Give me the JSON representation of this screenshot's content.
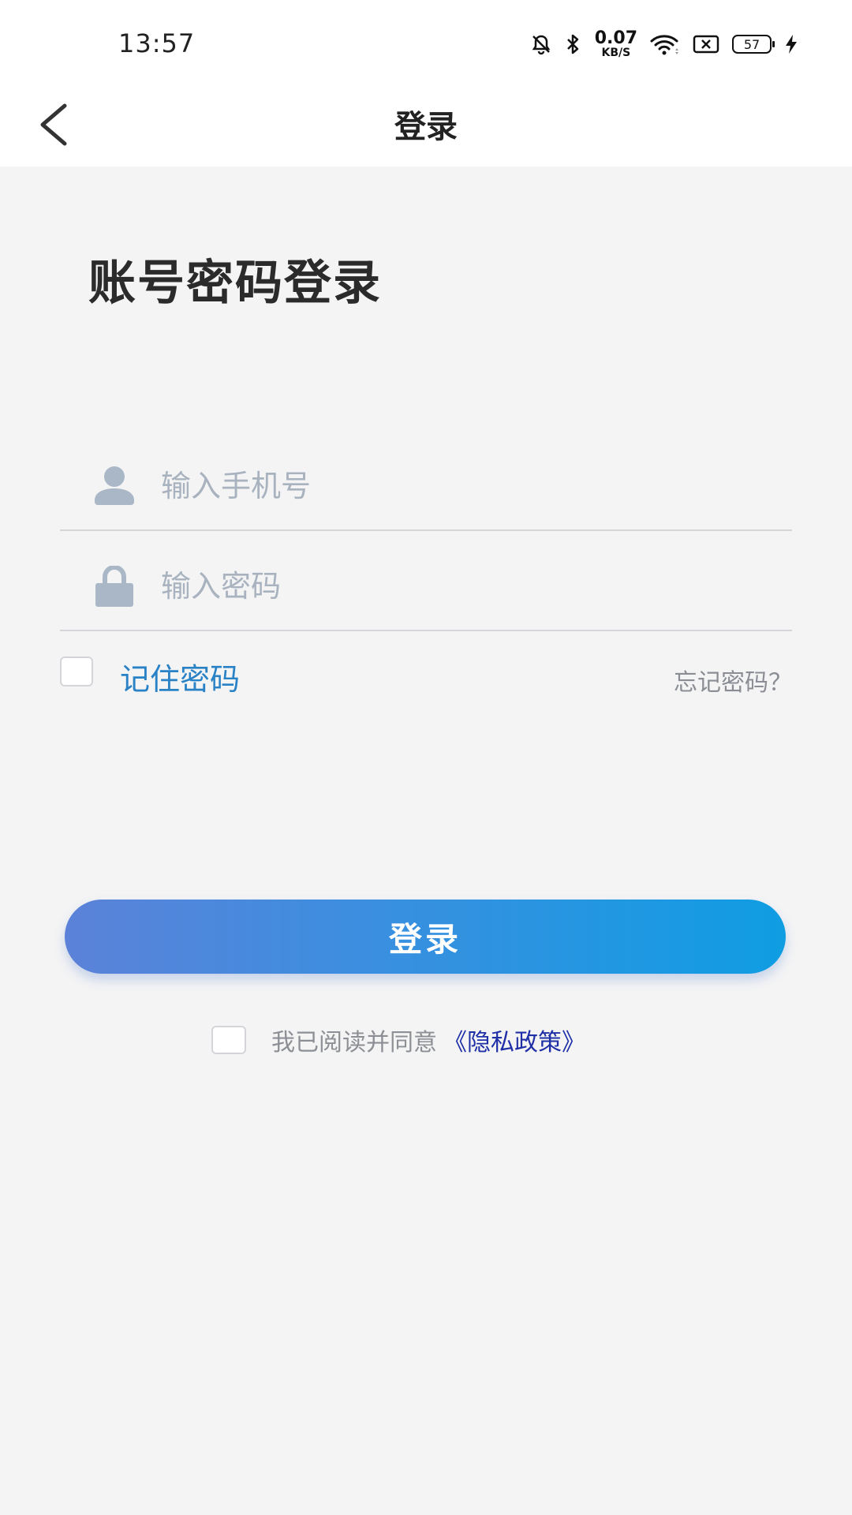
{
  "status_bar": {
    "time": "13:57",
    "net_speed_value": "0.07",
    "net_speed_unit": "KB/S",
    "battery_level": "57",
    "icons": [
      "bell-off-icon",
      "bluetooth-icon",
      "wifi-icon",
      "sim-off-icon",
      "battery-icon",
      "charging-icon"
    ]
  },
  "nav": {
    "back_icon": "chevron-left-icon",
    "title": "登录"
  },
  "heading": "账号密码登录",
  "form": {
    "phone": {
      "icon": "user-icon",
      "value": "",
      "placeholder": "输入手机号"
    },
    "password": {
      "icon": "lock-icon",
      "value": "",
      "placeholder": "输入密码"
    },
    "remember_label": "记住密码",
    "remember_checked": false,
    "forgot_label": "忘记密码？"
  },
  "login_button_label": "登录",
  "agreement": {
    "checked": false,
    "text": "我已阅读并同意",
    "link_label": "《隐私政策》"
  },
  "colors": {
    "accent_blue": "#2a82c6",
    "link_dark_blue": "#1f2fa6",
    "button_gradient_start": "#5b82d8",
    "button_gradient_end": "#0f9de2",
    "icon_gray": "#a9b7c6",
    "background": "#f4f4f5"
  }
}
